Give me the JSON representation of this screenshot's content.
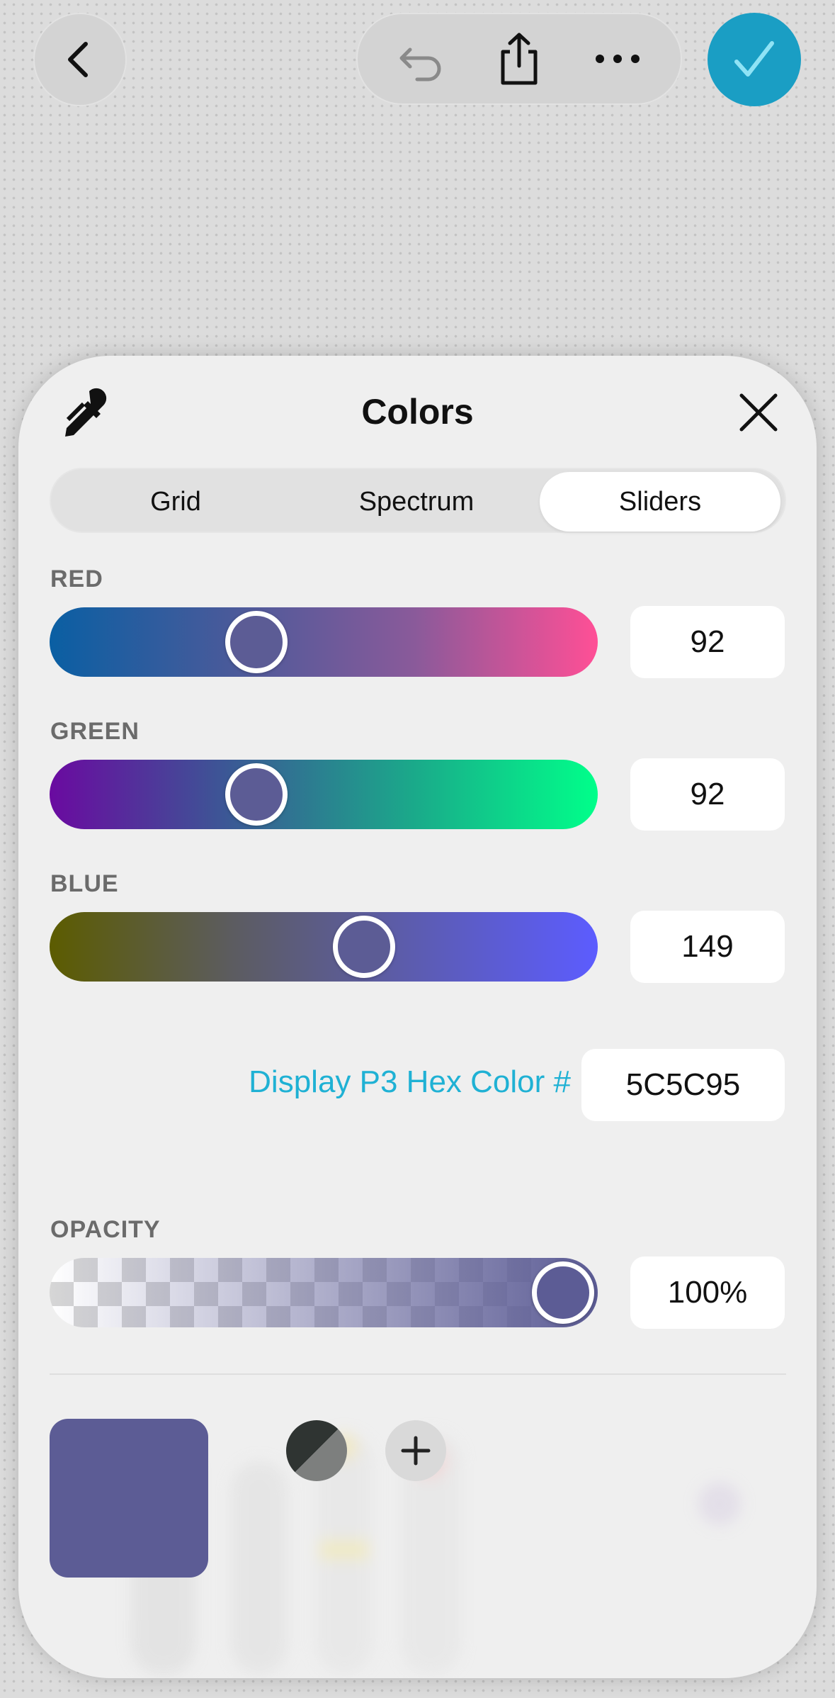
{
  "toolbar": {
    "back_icon": "chevron-left-icon",
    "undo_icon": "undo-icon",
    "share_icon": "share-icon",
    "more_icon": "ellipsis-icon",
    "done_icon": "checkmark-icon",
    "done_color": "#1a9ec4"
  },
  "colors_panel": {
    "title": "Colors",
    "eyedropper_icon": "eyedropper-icon",
    "close_icon": "close-icon",
    "tabs": [
      {
        "label": "Grid",
        "active": false
      },
      {
        "label": "Spectrum",
        "active": false
      },
      {
        "label": "Sliders",
        "active": true
      }
    ],
    "sliders": [
      {
        "label": "RED",
        "value": "92",
        "fraction": 0.36,
        "gradient": [
          "#0a5fa3",
          "#4a5a9a",
          "#8a5a9a",
          "#ff4f96"
        ]
      },
      {
        "label": "GREEN",
        "value": "92",
        "fraction": 0.36,
        "gradient": [
          "#6a0aa0",
          "#3a5a95",
          "#1aaa8a",
          "#00ff8a"
        ]
      },
      {
        "label": "BLUE",
        "value": "149",
        "fraction": 0.585,
        "gradient": [
          "#5c5c00",
          "#5c5c60",
          "#5c5cb0",
          "#5c5cff"
        ]
      }
    ],
    "hex": {
      "label": "Display P3 Hex Color #",
      "value": "5C5C95"
    },
    "opacity": {
      "label": "OPACITY",
      "value": "100%",
      "fraction": 1.0
    },
    "current_color": "#5c5c95",
    "bw_swatch_colors": [
      "#2f3432",
      "#7d7f7e"
    ],
    "add_icon": "plus-icon"
  }
}
